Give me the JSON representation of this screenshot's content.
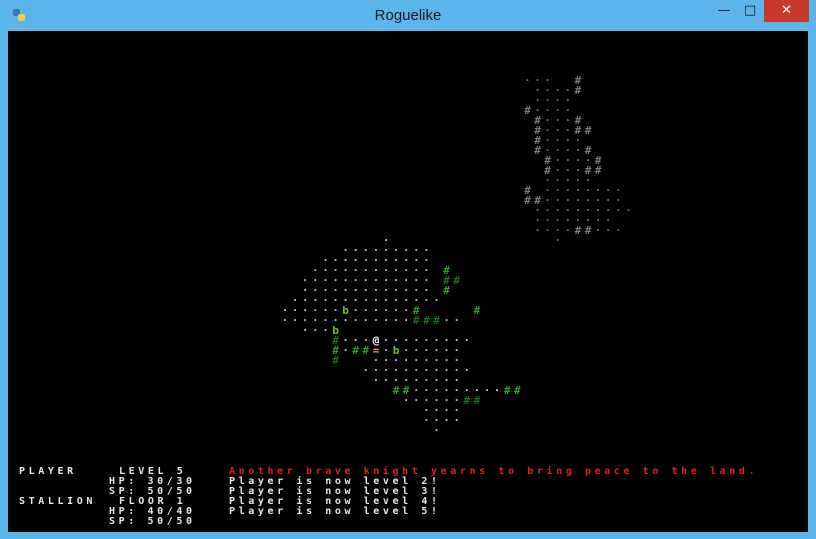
{
  "window": {
    "title": "Roguelike",
    "minimize_glyph": "—",
    "maximize_glyph": "□",
    "close_glyph": "✕",
    "app_icon": "python-icon"
  },
  "colors": {
    "titlebar": "#5bb4ea",
    "close": "#c7392b",
    "background": "#000000",
    "floor_dim": "#6a6a6a",
    "wall_dim": "#7a7a7a",
    "floor_visible": "#bdbdbd",
    "wall_visible": "#2f9a2f",
    "wall_visible_dark": "#1f6e1f",
    "monster": "#6fbf3f",
    "player": "#ffffff",
    "item": "#d8a23a",
    "message_alert": "#e01f1f",
    "message": "#e8e8e8"
  },
  "legend": {
    "floor": "·",
    "wall": "#",
    "player": "@",
    "monster": "b",
    "item": "="
  },
  "hud": {
    "player": {
      "name": "PLAYER",
      "level_label": "LEVEL 5",
      "hp": "HP: 30/30",
      "sp": "SP: 50/50"
    },
    "pet": {
      "name": "STALLION",
      "floor_label": "FLOOR 1",
      "hp": "HP: 40/40",
      "sp": "SP: 50/50"
    },
    "messages": [
      "Another brave knight yearns to bring peace to the land.",
      "Player is now level 2!",
      "Player is now level 3!",
      "Player is now level 4!",
      "Player is now level 5!"
    ]
  }
}
